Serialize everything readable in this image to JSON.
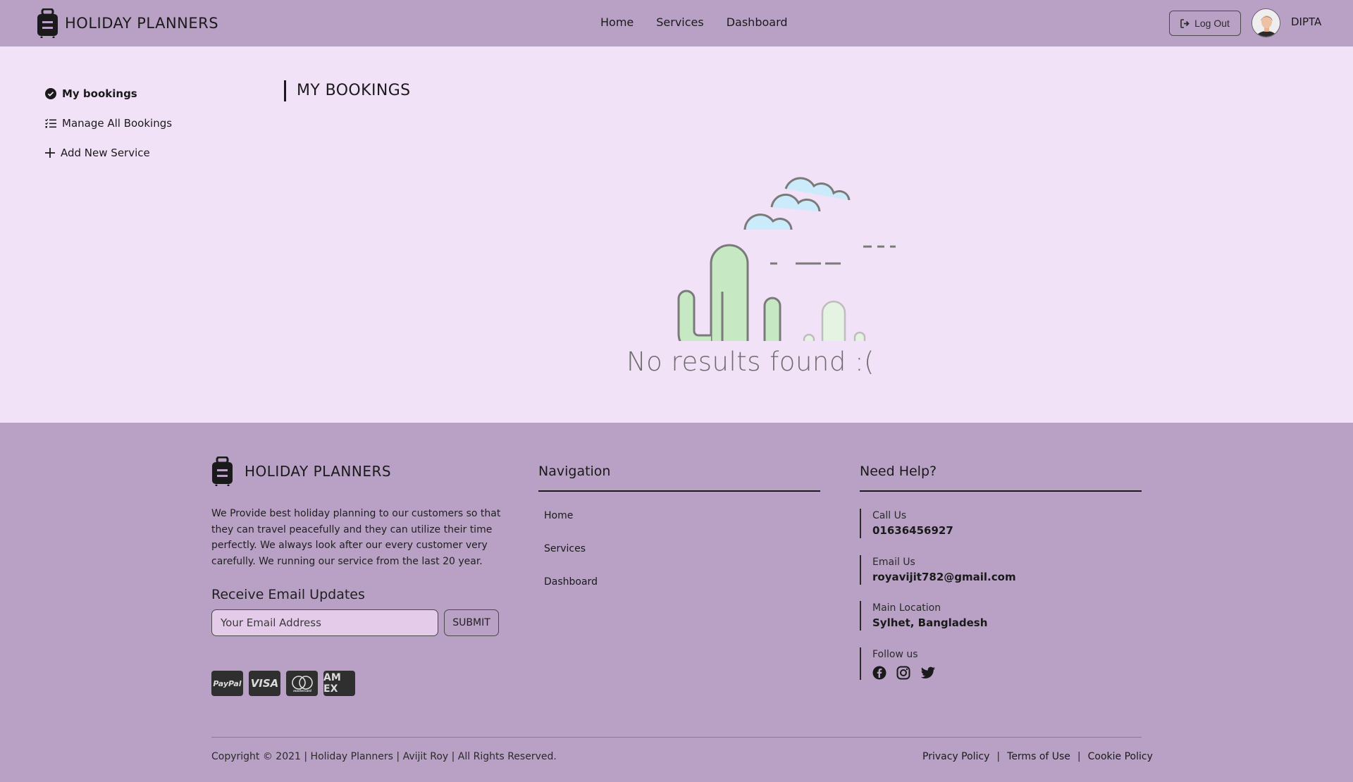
{
  "header": {
    "brand": "HOLIDAY PLANNERS",
    "nav": [
      "Home",
      "Services",
      "Dashboard"
    ],
    "logout_label": "Log Out",
    "username": "DIPTA"
  },
  "sidebar": {
    "items": [
      {
        "label": "My bookings",
        "icon": "check-circle-icon"
      },
      {
        "label": "Manage All Bookings",
        "icon": "list-check-icon"
      },
      {
        "label": "Add New Service",
        "icon": "plus-icon"
      }
    ]
  },
  "main": {
    "title": "MY BOOKINGS",
    "empty_text": "No results found :("
  },
  "footer": {
    "brand": "HOLIDAY PLANNERS",
    "about": "We Provide best holiday planning to our customers so that they can travel peacefully and they can utilize their time perfectly. We always look after our every customer very carefully. We running our service from the last 20 year.",
    "updates_title": "Receive Email Updates",
    "email_placeholder": "Your Email Address",
    "submit_label": "SUBMIT",
    "payments": [
      "PayPal",
      "VISA",
      "mastercard",
      "AM EX"
    ],
    "navigation": {
      "title": "Navigation",
      "links": [
        "Home",
        "Services",
        "Dashboard"
      ]
    },
    "help": {
      "title": "Need Help?",
      "call_label": "Call Us",
      "call_value": "01636456927",
      "email_label": "Email Us",
      "email_value": "royavijit782@gmail.com",
      "location_label": "Main Location",
      "location_value": "Sylhet, Bangladesh",
      "follow_label": "Follow us"
    },
    "copyright": "Copyright © 2021 | Holiday Planners | Avijit Roy | All Rights Reserved.",
    "policies": [
      "Privacy Policy",
      "Terms of Use",
      "Cookie Policy"
    ]
  },
  "colors": {
    "header_bg": "#b8a1c4",
    "main_bg": "#f2e2f8",
    "cactus_green": "#c6e8c2",
    "cloud_blue": "#cbeafa"
  }
}
